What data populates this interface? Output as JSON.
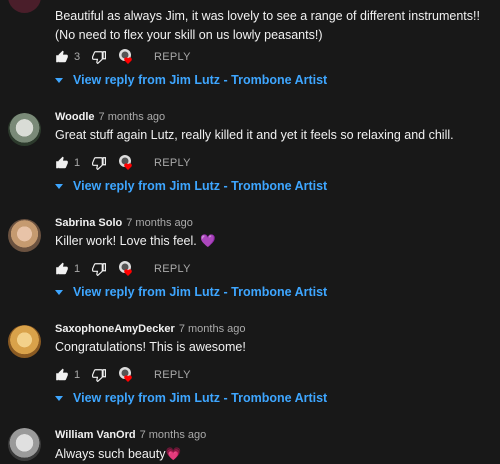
{
  "reply_label": "REPLY",
  "view_reply_label": "View reply from Jim Lutz - Trombone Artist",
  "comments": [
    {
      "author": "",
      "time": "",
      "text": "Beautiful as always Jim, it was lovely to see a range of different instruments!! (No need to flex your skill on us lowly peasants!)",
      "likes": "3"
    },
    {
      "author": "Woodle",
      "time": "7 months ago",
      "text": "Great stuff again Lutz, really killed it and yet it feels so relaxing and chill.",
      "likes": "1"
    },
    {
      "author": "Sabrina Solo",
      "time": "7 months ago",
      "text": "Killer work! Love this feel. 💜",
      "likes": "1"
    },
    {
      "author": "SaxophoneAmyDecker",
      "time": "7 months ago",
      "text": "Congratulations!  This is awesome!",
      "likes": "1"
    },
    {
      "author": "William VanOrd",
      "time": "7 months ago",
      "text": "Always such beauty💗",
      "likes": ""
    }
  ]
}
